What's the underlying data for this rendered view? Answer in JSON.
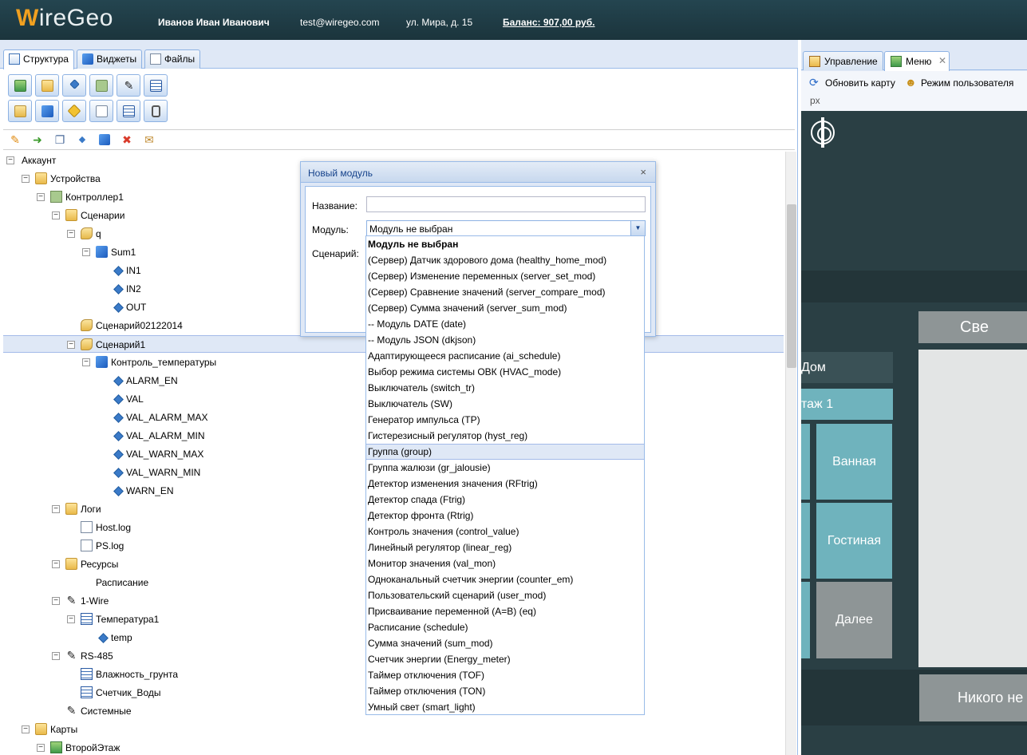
{
  "header": {
    "logo": "WireGeo",
    "user": "Иванов Иван Иванович",
    "email": "test@wiregeo.com",
    "address": "ул. Мира, д. 15",
    "balance": "Баланс: 907,00 руб."
  },
  "left_tabs": [
    "Структура",
    "Виджеты",
    "Файлы"
  ],
  "tree": {
    "nodes": [
      {
        "label": "Аккаунт",
        "icon": "none",
        "toggle": "−"
      },
      {
        "label": "Устройства",
        "icon": "folder-icon",
        "toggle": "−"
      },
      {
        "label": "Контроллер1",
        "icon": "controller-icon",
        "toggle": "−"
      },
      {
        "label": "Сценарии",
        "icon": "folder-icon",
        "toggle": "−"
      },
      {
        "label": "q",
        "icon": "script-icon",
        "toggle": "−"
      },
      {
        "label": "Sum1",
        "icon": "cube-icon",
        "toggle": "−"
      },
      {
        "label": "IN1",
        "icon": "diamond-icon",
        "toggle": ""
      },
      {
        "label": "IN2",
        "icon": "diamond-icon",
        "toggle": ""
      },
      {
        "label": "OUT",
        "icon": "diamond-icon",
        "toggle": ""
      },
      {
        "label": "Сценарий02122014",
        "icon": "script-icon",
        "toggle": ""
      },
      {
        "label": "Сценарий1",
        "icon": "script-icon",
        "toggle": "−"
      },
      {
        "label": "Контроль_температуры",
        "icon": "cube-icon",
        "toggle": "−"
      },
      {
        "label": "ALARM_EN",
        "icon": "diamond-icon",
        "toggle": ""
      },
      {
        "label": "VAL",
        "icon": "diamond-icon",
        "toggle": ""
      },
      {
        "label": "VAL_ALARM_MAX",
        "icon": "diamond-icon",
        "toggle": ""
      },
      {
        "label": "VAL_ALARM_MIN",
        "icon": "diamond-icon",
        "toggle": ""
      },
      {
        "label": "VAL_WARN_MAX",
        "icon": "diamond-icon",
        "toggle": ""
      },
      {
        "label": "VAL_WARN_MIN",
        "icon": "diamond-icon",
        "toggle": ""
      },
      {
        "label": "WARN_EN",
        "icon": "diamond-icon",
        "toggle": ""
      },
      {
        "label": "Логи",
        "icon": "folder-icon",
        "toggle": "−"
      },
      {
        "label": "Host.log",
        "icon": "file-icon",
        "toggle": ""
      },
      {
        "label": "PS.log",
        "icon": "file-icon",
        "toggle": ""
      },
      {
        "label": "Ресурсы",
        "icon": "folder-icon",
        "toggle": "−"
      },
      {
        "label": "Расписание",
        "icon": "none",
        "toggle": ""
      },
      {
        "label": "1-Wire",
        "icon": "plug-icon",
        "toggle": "−"
      },
      {
        "label": "Температура1",
        "icon": "sensor-icon",
        "toggle": "−"
      },
      {
        "label": "temp",
        "icon": "diamond-icon",
        "toggle": ""
      },
      {
        "label": "RS-485",
        "icon": "plug-icon",
        "toggle": "−"
      },
      {
        "label": "Влажность_грунта",
        "icon": "sensor-icon",
        "toggle": ""
      },
      {
        "label": "Счетчик_Воды",
        "icon": "sensor-icon",
        "toggle": ""
      },
      {
        "label": "Системные",
        "icon": "plug-icon",
        "toggle": ""
      },
      {
        "label": "Карты",
        "icon": "folder-icon",
        "toggle": "−"
      },
      {
        "label": "ВторойЭтаж",
        "icon": "map-icon",
        "toggle": "−"
      }
    ],
    "selected_label": "Сценарий1"
  },
  "right_tabs": [
    "Управление",
    "Меню"
  ],
  "right_toolbar": {
    "refresh": "Обновить карту",
    "user_mode": "Режим пользователя",
    "unit": "px"
  },
  "map_blocks": {
    "top_right": "Све",
    "home": "Дом",
    "floor": "таж 1",
    "bathroom": "Ванная",
    "living": "Гостиная",
    "next": "Далее",
    "nobody": "Никого не"
  },
  "modal": {
    "title": "Новый модуль",
    "close": "×",
    "name_label": "Название:",
    "name_value": "",
    "module_label": "Модуль:",
    "module_value": "Модуль не выбран",
    "scenario_label": "Сценарий:"
  },
  "dropdown_options": [
    "Модуль не выбран",
    "(Сервер) Датчик здорового дома (healthy_home_mod)",
    "(Сервер) Изменение переменных (server_set_mod)",
    "(Сервер) Сравнение значений (server_compare_mod)",
    "(Сервер) Сумма значений (server_sum_mod)",
    "-- Модуль DATE (date)",
    "-- Модуль JSON (dkjson)",
    "Адаптирующееся расписание (ai_schedule)",
    "Выбор режима системы ОВК (HVAC_mode)",
    "Выключатель (switch_tr)",
    "Выключатель (SW)",
    "Генератор импульса (TP)",
    "Гистерезисный регулятор (hyst_reg)",
    "Группа (group)",
    "Группа жалюзи (gr_jalousie)",
    "Детектор изменения значения (RFtrig)",
    "Детектор спада (Ftrig)",
    "Детектор фронта (Rtrig)",
    "Контроль значения (control_value)",
    "Линейный регулятор (linear_reg)",
    "Монитор значения (val_mon)",
    "Одноканальный счетчик энергии (counter_em)",
    "Пользовательский сценарий (user_mod)",
    "Присваивание переменной (A=B) (eq)",
    "Расписание (schedule)",
    "Сумма значений (sum_mod)",
    "Счетчик энергии (Energy_meter)",
    "Таймер отключения (TOF)",
    "Таймер отключения (TON)",
    "Умный свет (smart_light)"
  ],
  "dropdown_highlighted": "Группа (group)",
  "colors": {
    "header_bg": "#1f3a43",
    "panel_border": "#99bbe8",
    "map_bg": "#2a3f44",
    "room_teal": "#6fb3bd",
    "room_gray": "#8e9596"
  }
}
